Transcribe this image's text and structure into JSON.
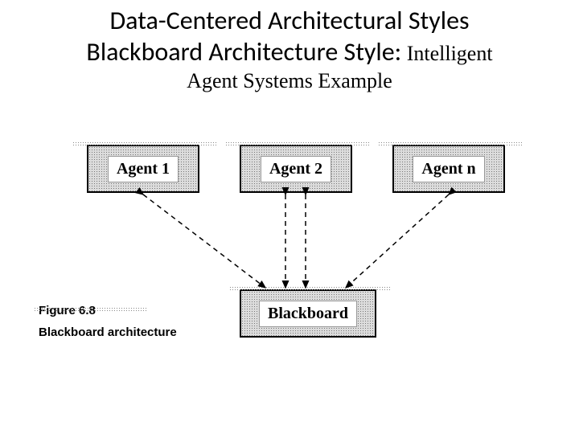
{
  "title": {
    "line1": "Data-Centered Architectural Styles",
    "line2_main": "Blackboard Architecture Style:",
    "line2_sub": " Intelligent",
    "line3": "Agent Systems Example"
  },
  "diagram": {
    "agents": [
      {
        "label": "Agent 1"
      },
      {
        "label": "Agent 2"
      },
      {
        "label": "Agent n"
      }
    ],
    "blackboard": {
      "label": "Blackboard"
    }
  },
  "figure": {
    "number": "Figure 6.8",
    "caption": "Blackboard architecture"
  }
}
